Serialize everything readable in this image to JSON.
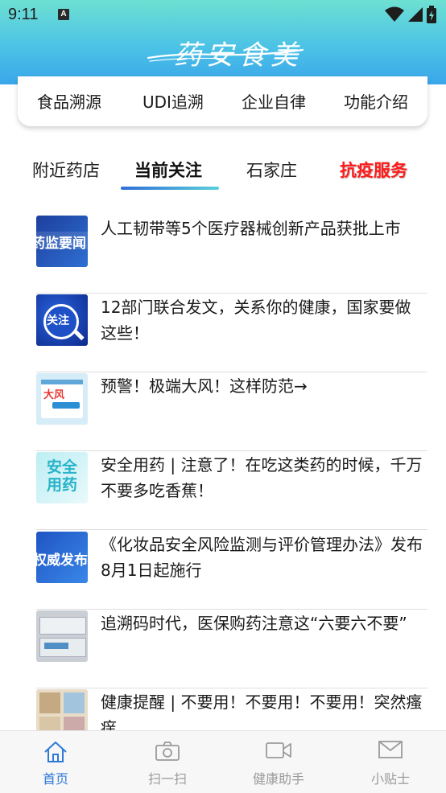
{
  "status_bar": {
    "time": "9:11",
    "notification_letter": "A"
  },
  "header": {
    "logo_text": "药安食美"
  },
  "functions": [
    {
      "label": "食品溯源"
    },
    {
      "label": "UDI追溯"
    },
    {
      "label": "企业自律"
    },
    {
      "label": "功能介绍"
    }
  ],
  "tabs": [
    {
      "label": "附近药店",
      "active": false
    },
    {
      "label": "当前关注",
      "active": true
    },
    {
      "label": "石家庄",
      "active": false
    },
    {
      "label": "抗疫服务",
      "active": false,
      "color": "#ff1a1a"
    }
  ],
  "news": [
    {
      "title": "人工韧带等5个医疗器械创新产品获批上市",
      "thumb_text": "药监要闻",
      "thumb_icon": "news-thumbnail"
    },
    {
      "title": "12部门联合发文，关系你的健康，国家要做这些！",
      "thumb_text": "关注",
      "thumb_icon": "attention-magnifier-thumbnail"
    },
    {
      "title": "预警！极端大风！这样防范→",
      "thumb_text": "大风",
      "thumb_icon": "calendar-warning-thumbnail"
    },
    {
      "title": "安全用药 | 注意了！在吃这类药的时候，千万不要多吃香蕉！",
      "thumb_text": "安全用药",
      "thumb_icon": "safety-medicine-thumbnail"
    },
    {
      "title": "《化妆品安全风险监测与评价管理办法》发布 8月1日起施行",
      "thumb_text": "权威发布",
      "thumb_icon": "authority-release-thumbnail"
    },
    {
      "title": "追溯码时代，医保购药注意这“六要六不要”",
      "thumb_text": "",
      "thumb_icon": "medicine-box-photo-thumbnail"
    },
    {
      "title": "健康提醒 | 不要用！不要用！不要用！突然瘙痒",
      "thumb_text": "",
      "thumb_icon": "products-photo-thumbnail"
    }
  ],
  "bottom_nav": [
    {
      "label": "首页",
      "icon": "home-icon",
      "active": true
    },
    {
      "label": "扫一扫",
      "icon": "camera-icon",
      "active": false
    },
    {
      "label": "健康助手",
      "icon": "video-camera-icon",
      "active": false
    },
    {
      "label": "小贴士",
      "icon": "mail-icon",
      "active": false
    }
  ],
  "colors": {
    "accent": "#2f79d8",
    "header_top": "#6ee0d2",
    "header_bottom": "#3aa6ea",
    "alert": "#ff1a1a"
  }
}
